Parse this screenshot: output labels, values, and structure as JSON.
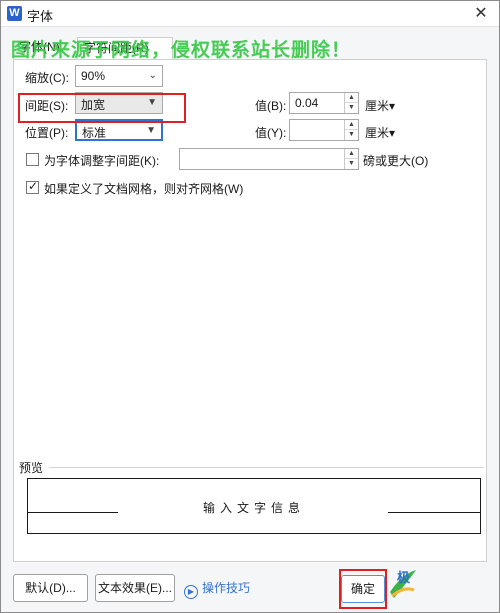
{
  "window": {
    "app_icon": "W",
    "title": "字体",
    "close_glyph": "✕"
  },
  "tabs": [
    {
      "label": "字体(N)"
    },
    {
      "label": "字符间距(R)"
    }
  ],
  "watermark": "图片来源于网络，侵权联系站长删除！",
  "scale": {
    "label": "缩放(C):",
    "value": "90%"
  },
  "spacing": {
    "label": "间距(S):",
    "value": "加宽",
    "by_label": "值(B):",
    "by_value": "0.04",
    "unit": "厘米▾"
  },
  "position": {
    "label": "位置(P):",
    "value": "标准",
    "by_label": "值(Y):",
    "by_value": "",
    "unit": "厘米▾"
  },
  "kerning": {
    "label": "为字体调整字间距(K):",
    "value": "",
    "suffix": "磅或更大(O)",
    "checked": false
  },
  "grid": {
    "label": "如果定义了文档网格，则对齐网格(W)",
    "checked": true
  },
  "preview": {
    "title": "预览",
    "text": "输入文字信息"
  },
  "buttons": {
    "default": "默认(D)...",
    "text_effects": "文本效果(E)...",
    "tips": "操作技巧",
    "ok": "确定"
  },
  "logo_text": "极"
}
